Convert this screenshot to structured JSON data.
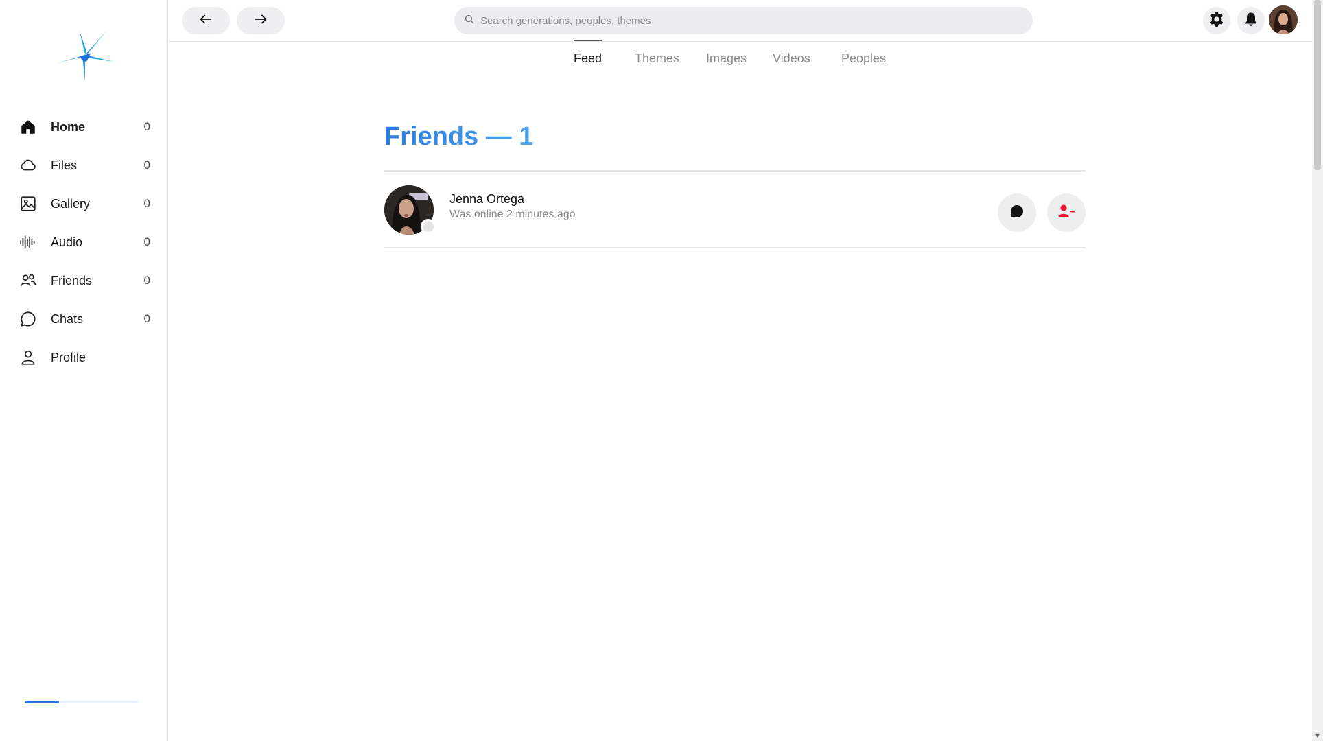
{
  "sidebar": {
    "logo_icon": "star-logo-icon",
    "items": [
      {
        "label": "Home",
        "count": "0",
        "icon": "home-icon",
        "active": true
      },
      {
        "label": "Files",
        "count": "0",
        "icon": "cloud-icon"
      },
      {
        "label": "Gallery",
        "count": "0",
        "icon": "image-icon"
      },
      {
        "label": "Audio",
        "count": "0",
        "icon": "waveform-icon"
      },
      {
        "label": "Friends",
        "count": "0",
        "icon": "users-icon"
      },
      {
        "label": "Chats",
        "count": "0",
        "icon": "chat-bubble-icon"
      },
      {
        "label": "Profile",
        "count": "",
        "icon": "user-icon"
      }
    ],
    "progress_fraction": 0.3
  },
  "topbar": {
    "back_icon": "arrow-left-icon",
    "forward_icon": "arrow-right-icon",
    "search_placeholder": "Search generations, peoples, themes",
    "search_value": "",
    "settings_icon": "gear-icon",
    "notifications_icon": "bell-icon"
  },
  "tabs": [
    {
      "label": "Feed",
      "active": true
    },
    {
      "label": "Themes"
    },
    {
      "label": "Images"
    },
    {
      "label": "Videos"
    },
    {
      "label": "Peoples"
    }
  ],
  "main": {
    "title": "Friends — 1",
    "friends": [
      {
        "name": "Jenna Ortega",
        "status": "Was online 2 minutes ago",
        "presence": "offline"
      }
    ]
  },
  "colors": {
    "accent": "#2a7de1",
    "accent_light": "#4aa3ef",
    "remove_friend": "#e8112d",
    "progress": "#2f6fe6"
  }
}
